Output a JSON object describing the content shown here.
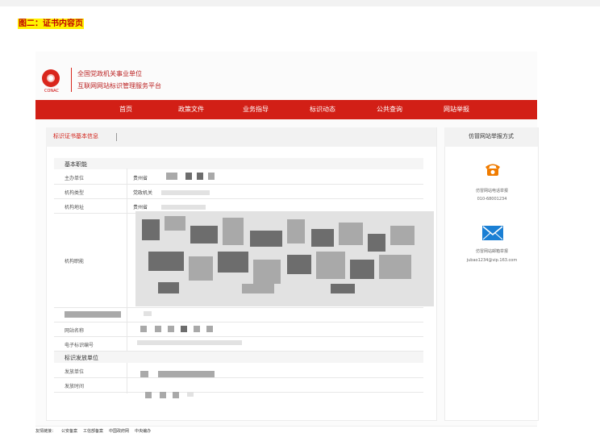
{
  "caption": "图二：证书内容页",
  "header": {
    "logo_text": "CONAC",
    "brand_line1": "全国党政机关事业单位",
    "brand_line2": "互联网网站标识管理服务平台"
  },
  "nav": {
    "items": [
      {
        "label": "首页"
      },
      {
        "label": "政策文件"
      },
      {
        "label": "业务指导"
      },
      {
        "label": "标识动态"
      },
      {
        "label": "公共查询"
      },
      {
        "label": "网站举报"
      }
    ]
  },
  "cert_panel": {
    "title": "标识证书基本信息",
    "sections": {
      "basic": "基本职能",
      "issuer": "标识发放单位"
    },
    "rows": {
      "org": "主办单位",
      "org_type": "机构类型",
      "address": "机构地址",
      "duties": "机构职能",
      "site_name": "网站名称",
      "e_id": "电子标识编号",
      "issuer_unit": "发放单位",
      "issue_time": "发放时间"
    },
    "partial_values": {
      "org_value": "贵州省",
      "type_value": "党政机关",
      "address_value": "贵州省"
    }
  },
  "report_panel": {
    "title": "仿冒网站举报方式",
    "phone_label": "仿冒网站电话举报",
    "phone_number": "010-68001234",
    "mail_label": "仿冒网站邮箱举报",
    "mail_address": "jubao1234@vip.163.com",
    "phone_color": "#f07c00",
    "mail_color": "#1a7fd4"
  },
  "footer": {
    "label": "友情链接：",
    "links": [
      "公安备案",
      "工信部备案",
      "中国政府网",
      "中央编办"
    ]
  }
}
